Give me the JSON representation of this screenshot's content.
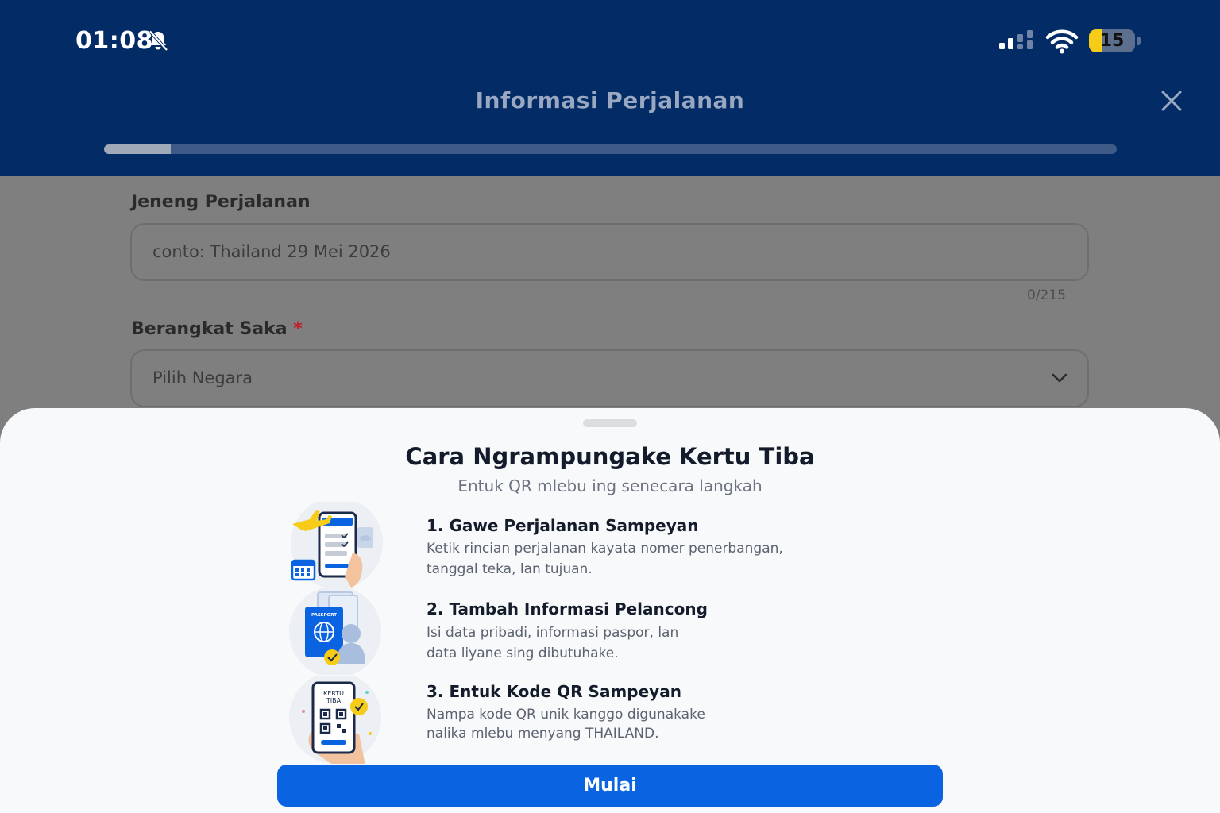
{
  "status_bar": {
    "time": "01:08",
    "battery": "15",
    "battery_fraction": 0.3
  },
  "header": {
    "title": "Informasi Perjalanan",
    "progress_fraction": 0.066
  },
  "form": {
    "trip_name_label": "Jeneng Perjalanan",
    "trip_name_placeholder": "conto: Thailand 29 Mei 2026",
    "trip_name_counter": "0/215",
    "depart_label": "Berangkat Saka",
    "depart_required": "*",
    "depart_value": "Pilih Negara"
  },
  "sheet": {
    "title": "Cara Ngrampungake Kertu Tiba",
    "subtitle": "Entuk QR mlebu ing senecara langkah",
    "steps": [
      {
        "title": "1. Gawe Perjalanan Sampeyan",
        "desc": [
          "Ketik rincian perjalanan kayata nomer penerbangan,",
          "tanggal teka, lan tujuan."
        ],
        "icon": "plane-phone-icon"
      },
      {
        "title": "2. Tambah Informasi Pelancong",
        "desc": [
          "Isi data pribadi, informasi paspor, lan",
          "data liyane sing dibutuhake."
        ],
        "icon": "passport-icon",
        "passport_label": "PASSPORT"
      },
      {
        "title": "3. Entuk Kode QR Sampeyan",
        "desc": [
          "Nampa kode QR unik kanggo digunakake",
          "nalika mlebu menyang THAILAND."
        ],
        "icon": "qr-phone-icon",
        "card_label_1": "KERTU",
        "card_label_2": "TIBA"
      }
    ],
    "cta_label": "Mulai"
  },
  "colors": {
    "header_bg": "#032c66",
    "accent": "#0a63e0",
    "battery": "#f6cc19"
  }
}
